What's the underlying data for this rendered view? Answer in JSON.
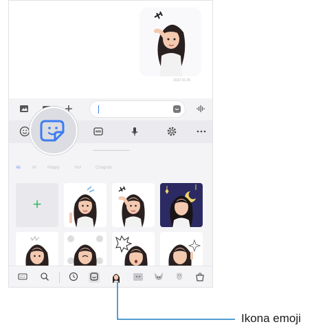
{
  "chat": {
    "message_time": "2022.10.25"
  },
  "compose": {
    "icons": [
      "image-icon",
      "camera-icon",
      "plus-icon",
      "sticker-icon",
      "voice-wave-icon"
    ]
  },
  "toolbar": {
    "icons": [
      "emoji-icon",
      "sticker-icon",
      "gif-icon",
      "microphone-icon",
      "settings-icon",
      "more-icon"
    ]
  },
  "categories": [
    "All",
    "Hi",
    "Happy",
    "No!",
    "Congrats"
  ],
  "bottom_bar": {
    "icons": [
      "keyboard-icon",
      "search-icon",
      "recent-icon",
      "sticker-icon",
      "ar-emoji-icon",
      "emoji-face-icon",
      "animal-icon",
      "mask-icon",
      "store-icon"
    ]
  },
  "callout": {
    "label": "Ikona emoji"
  },
  "colors": {
    "accent_blue": "#4a7ff0",
    "add_green": "#3dba6b",
    "callout_line": "#1a7fc1"
  }
}
